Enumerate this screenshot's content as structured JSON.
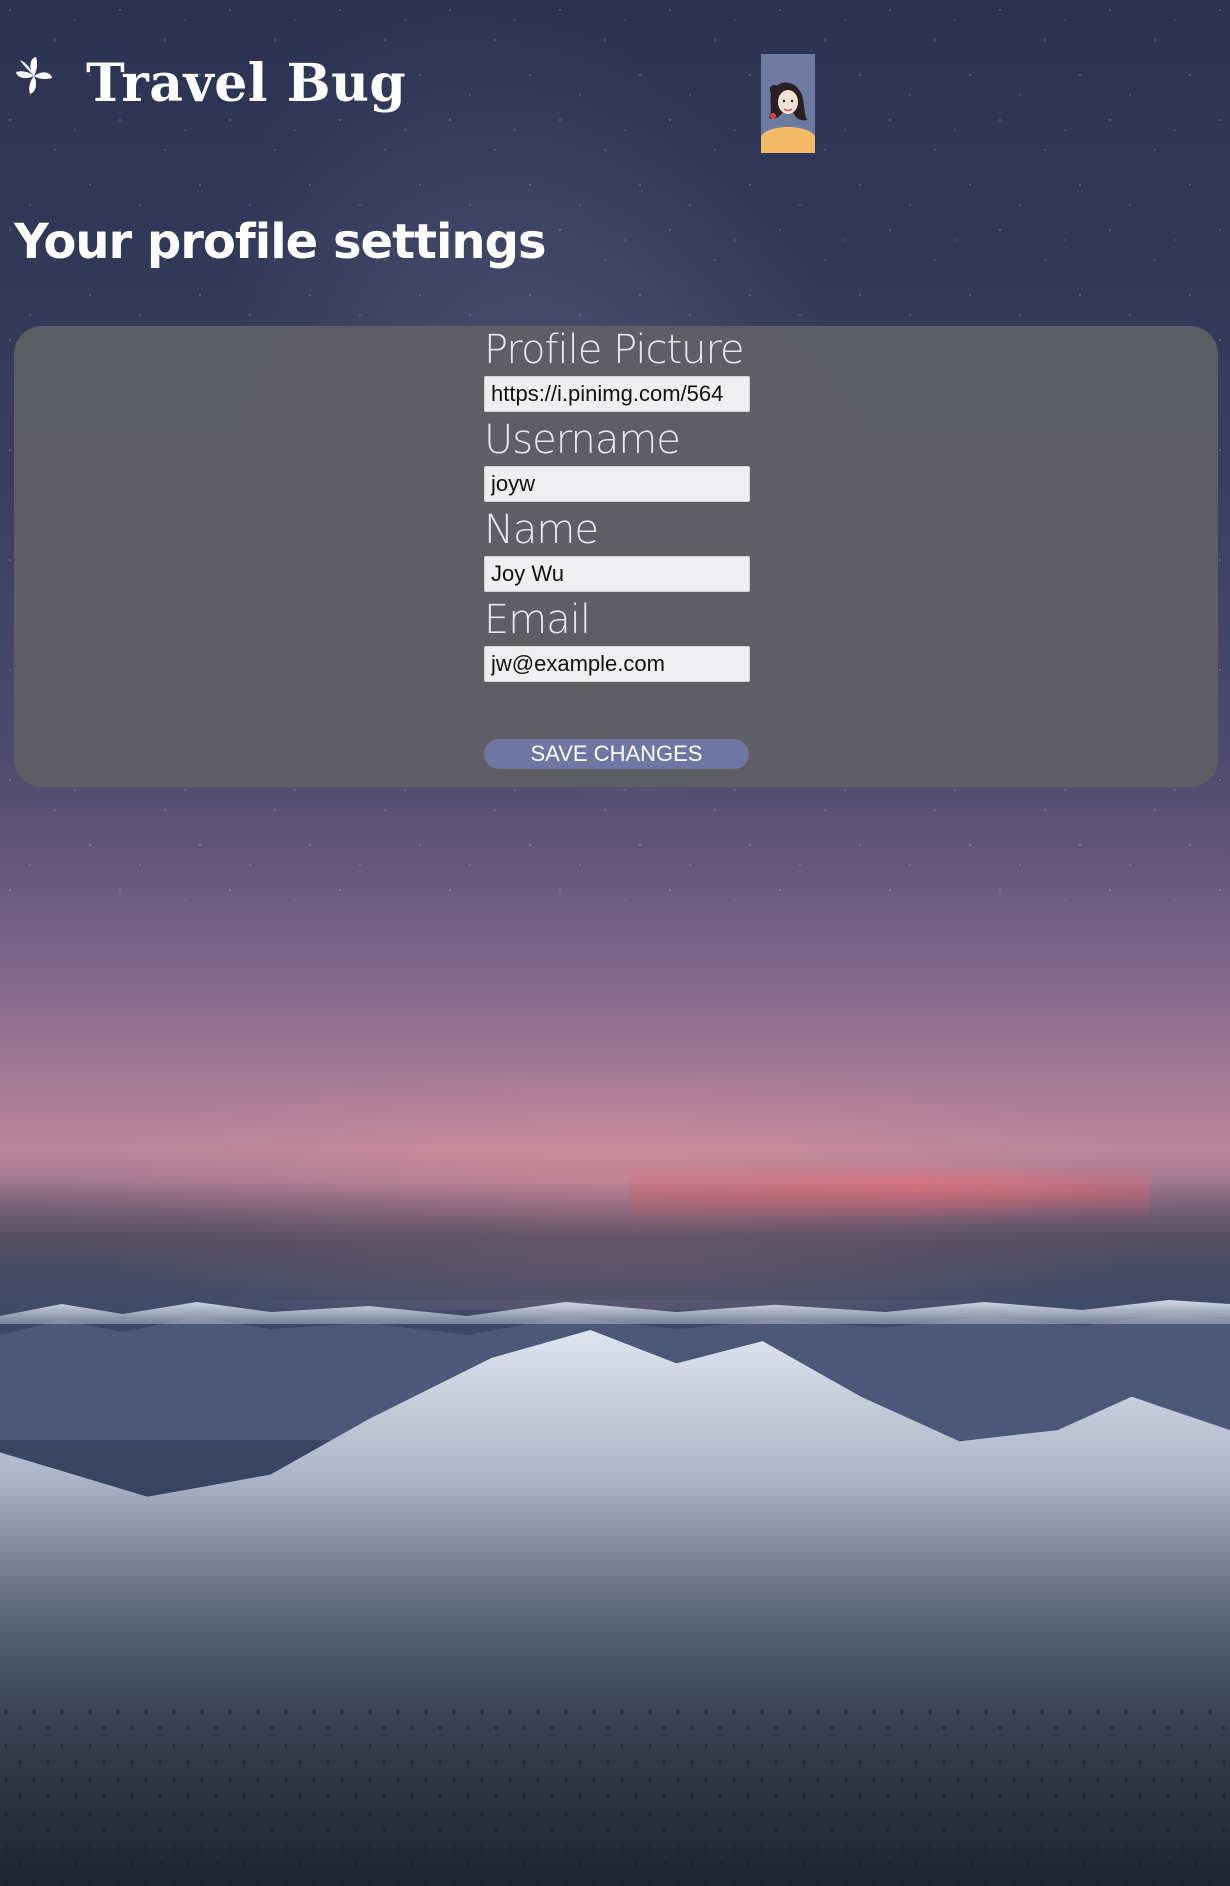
{
  "header": {
    "brand": "Travel Bug",
    "logo_icon": "flower-icon",
    "avatar": "user-avatar-illustration"
  },
  "page": {
    "title": "Your profile settings"
  },
  "form": {
    "profile_picture": {
      "label": "Profile Picture",
      "value": "https://i.pinimg.com/564"
    },
    "username": {
      "label": "Username",
      "value": "joyw"
    },
    "name": {
      "label": "Name",
      "value": "Joy Wu"
    },
    "email": {
      "label": "Email",
      "value": "jw@example.com"
    },
    "save_label": "SAVE CHANGES"
  },
  "colors": {
    "card": "#5f5f64",
    "button": "#6f76a3",
    "text": "#ffffff"
  }
}
